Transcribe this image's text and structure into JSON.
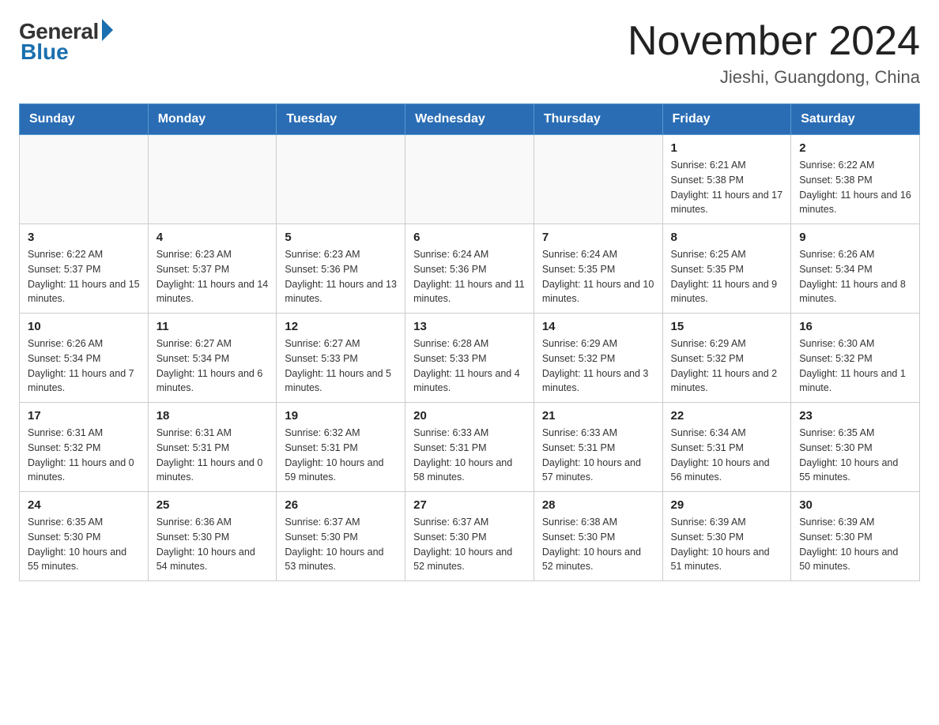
{
  "header": {
    "logo_general": "General",
    "logo_blue": "Blue",
    "month_title": "November 2024",
    "location": "Jieshi, Guangdong, China"
  },
  "weekdays": [
    "Sunday",
    "Monday",
    "Tuesday",
    "Wednesday",
    "Thursday",
    "Friday",
    "Saturday"
  ],
  "weeks": [
    [
      {
        "day": "",
        "info": ""
      },
      {
        "day": "",
        "info": ""
      },
      {
        "day": "",
        "info": ""
      },
      {
        "day": "",
        "info": ""
      },
      {
        "day": "",
        "info": ""
      },
      {
        "day": "1",
        "info": "Sunrise: 6:21 AM\nSunset: 5:38 PM\nDaylight: 11 hours and 17 minutes."
      },
      {
        "day": "2",
        "info": "Sunrise: 6:22 AM\nSunset: 5:38 PM\nDaylight: 11 hours and 16 minutes."
      }
    ],
    [
      {
        "day": "3",
        "info": "Sunrise: 6:22 AM\nSunset: 5:37 PM\nDaylight: 11 hours and 15 minutes."
      },
      {
        "day": "4",
        "info": "Sunrise: 6:23 AM\nSunset: 5:37 PM\nDaylight: 11 hours and 14 minutes."
      },
      {
        "day": "5",
        "info": "Sunrise: 6:23 AM\nSunset: 5:36 PM\nDaylight: 11 hours and 13 minutes."
      },
      {
        "day": "6",
        "info": "Sunrise: 6:24 AM\nSunset: 5:36 PM\nDaylight: 11 hours and 11 minutes."
      },
      {
        "day": "7",
        "info": "Sunrise: 6:24 AM\nSunset: 5:35 PM\nDaylight: 11 hours and 10 minutes."
      },
      {
        "day": "8",
        "info": "Sunrise: 6:25 AM\nSunset: 5:35 PM\nDaylight: 11 hours and 9 minutes."
      },
      {
        "day": "9",
        "info": "Sunrise: 6:26 AM\nSunset: 5:34 PM\nDaylight: 11 hours and 8 minutes."
      }
    ],
    [
      {
        "day": "10",
        "info": "Sunrise: 6:26 AM\nSunset: 5:34 PM\nDaylight: 11 hours and 7 minutes."
      },
      {
        "day": "11",
        "info": "Sunrise: 6:27 AM\nSunset: 5:34 PM\nDaylight: 11 hours and 6 minutes."
      },
      {
        "day": "12",
        "info": "Sunrise: 6:27 AM\nSunset: 5:33 PM\nDaylight: 11 hours and 5 minutes."
      },
      {
        "day": "13",
        "info": "Sunrise: 6:28 AM\nSunset: 5:33 PM\nDaylight: 11 hours and 4 minutes."
      },
      {
        "day": "14",
        "info": "Sunrise: 6:29 AM\nSunset: 5:32 PM\nDaylight: 11 hours and 3 minutes."
      },
      {
        "day": "15",
        "info": "Sunrise: 6:29 AM\nSunset: 5:32 PM\nDaylight: 11 hours and 2 minutes."
      },
      {
        "day": "16",
        "info": "Sunrise: 6:30 AM\nSunset: 5:32 PM\nDaylight: 11 hours and 1 minute."
      }
    ],
    [
      {
        "day": "17",
        "info": "Sunrise: 6:31 AM\nSunset: 5:32 PM\nDaylight: 11 hours and 0 minutes."
      },
      {
        "day": "18",
        "info": "Sunrise: 6:31 AM\nSunset: 5:31 PM\nDaylight: 11 hours and 0 minutes."
      },
      {
        "day": "19",
        "info": "Sunrise: 6:32 AM\nSunset: 5:31 PM\nDaylight: 10 hours and 59 minutes."
      },
      {
        "day": "20",
        "info": "Sunrise: 6:33 AM\nSunset: 5:31 PM\nDaylight: 10 hours and 58 minutes."
      },
      {
        "day": "21",
        "info": "Sunrise: 6:33 AM\nSunset: 5:31 PM\nDaylight: 10 hours and 57 minutes."
      },
      {
        "day": "22",
        "info": "Sunrise: 6:34 AM\nSunset: 5:31 PM\nDaylight: 10 hours and 56 minutes."
      },
      {
        "day": "23",
        "info": "Sunrise: 6:35 AM\nSunset: 5:30 PM\nDaylight: 10 hours and 55 minutes."
      }
    ],
    [
      {
        "day": "24",
        "info": "Sunrise: 6:35 AM\nSunset: 5:30 PM\nDaylight: 10 hours and 55 minutes."
      },
      {
        "day": "25",
        "info": "Sunrise: 6:36 AM\nSunset: 5:30 PM\nDaylight: 10 hours and 54 minutes."
      },
      {
        "day": "26",
        "info": "Sunrise: 6:37 AM\nSunset: 5:30 PM\nDaylight: 10 hours and 53 minutes."
      },
      {
        "day": "27",
        "info": "Sunrise: 6:37 AM\nSunset: 5:30 PM\nDaylight: 10 hours and 52 minutes."
      },
      {
        "day": "28",
        "info": "Sunrise: 6:38 AM\nSunset: 5:30 PM\nDaylight: 10 hours and 52 minutes."
      },
      {
        "day": "29",
        "info": "Sunrise: 6:39 AM\nSunset: 5:30 PM\nDaylight: 10 hours and 51 minutes."
      },
      {
        "day": "30",
        "info": "Sunrise: 6:39 AM\nSunset: 5:30 PM\nDaylight: 10 hours and 50 minutes."
      }
    ]
  ]
}
